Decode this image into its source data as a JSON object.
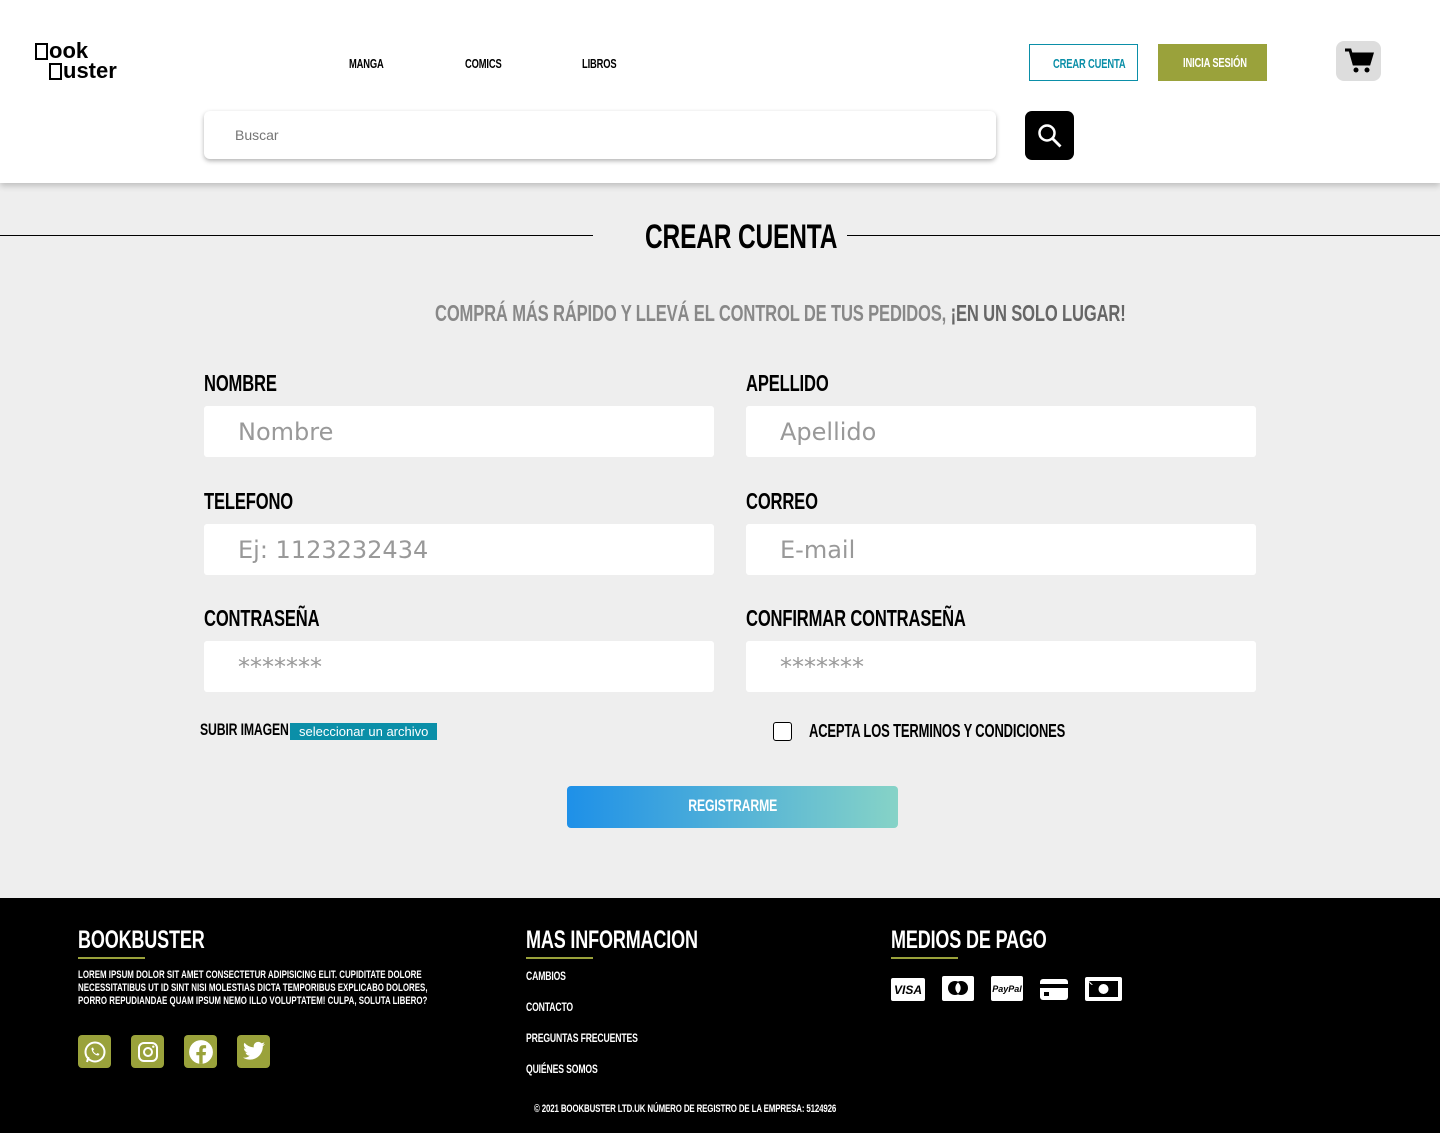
{
  "header": {
    "logo_line1": "ook",
    "logo_line2": "uster",
    "nav": [
      "MANGA",
      "COMICS",
      "LIBROS"
    ],
    "crear_cuenta": "CREAR CUENTA",
    "inicia_sesion": "INICIA SESIÓN",
    "search_placeholder": "Buscar"
  },
  "form": {
    "title": "CREAR CUENTA",
    "subtitle": "COMPRÁ MÁS RÁPIDO Y LLEVÁ EL CONTROL DE TUS PEDIDOS, ",
    "subtitle_bold": "¡EN UN SOLO LUGAR!",
    "fields": [
      {
        "label": "NOMBRE",
        "placeholder": "Nombre"
      },
      {
        "label": "APELLIDO",
        "placeholder": "Apellido"
      },
      {
        "label": "TELEFONO",
        "placeholder": "Ej: 1123232434"
      },
      {
        "label": "CORREO",
        "placeholder": "E-mail"
      },
      {
        "label": "CONTRASEÑA",
        "placeholder": "*******"
      },
      {
        "label": "CONFIRMAR CONTRASEÑA",
        "placeholder": "*******"
      }
    ],
    "upload_label": "SUBIR IMAGEN",
    "upload_button": "seleccionar un archivo",
    "terms": "ACEPTA LOS TERMINOS Y CONDICIONES",
    "submit": "REGISTRARME"
  },
  "footer": {
    "brand": "BOOKBUSTER",
    "about": "LOREM IPSUM DOLOR SIT AMET CONSECTETUR ADIPISICING ELIT. CUPIDITATE DOLORE NECESSITATIBUS UT ID SINT NISI MOLESTIAS DICTA TEMPORIBUS EXPLICABO DOLORES, PORRO REPUDIANDAE QUAM IPSUM NEMO ILLO VOLUPTATEM! CULPA, SOLUTA LIBERO?",
    "info_title": "MAS INFORMACION",
    "links": [
      "CAMBIOS",
      "CONTACTO",
      "PREGUNTAS FRECUENTES",
      "QUIÉNES SOMOS"
    ],
    "pay_title": "MEDIOS DE PAGO",
    "visa": "VISA",
    "paypal": "PayPal",
    "copyright": "© 2021 BOOKBUSTER LTD.UK NÚMERO DE REGISTRO DE LA EMPRESA: 5124926"
  },
  "colors": {
    "accent": "#9aa23b",
    "teal": "#0b8fa8"
  }
}
